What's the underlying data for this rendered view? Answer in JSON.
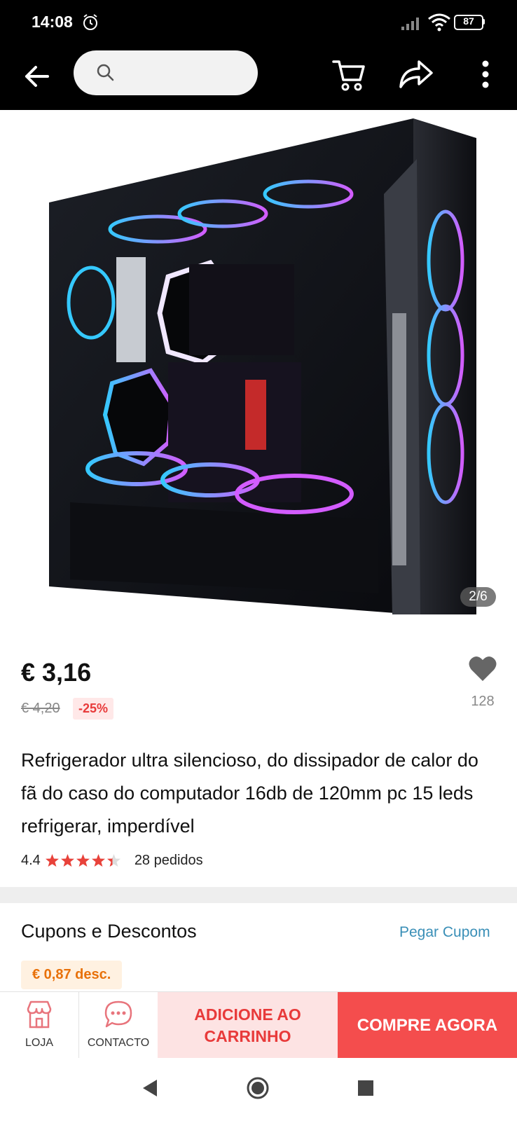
{
  "status_bar": {
    "time": "14:08",
    "battery_level": "87",
    "icons": [
      "alarm-icon",
      "signal-icon",
      "wifi-icon",
      "battery-icon"
    ]
  },
  "top_bar": {
    "search_placeholder": "",
    "icons": [
      "back-arrow-icon",
      "search-icon",
      "cart-icon",
      "share-icon",
      "more-vertical-icon"
    ]
  },
  "product": {
    "image_description_icon": "pc-case-image",
    "image_counter": "2/6",
    "price": "€ 3,16",
    "old_price": "€ 4,20",
    "discount": "-25%",
    "wishlist_count": "128",
    "title": "Refrigerador ultra silencioso, do dissipador de calor do fã do caso do computador 16db de 120mm pc 15 leds refrigerar, imperdível",
    "rating": "4.4",
    "rating_stars": 4.4,
    "orders": "28 pedidos"
  },
  "coupons": {
    "title": "Cupons e Descontos",
    "link": "Pegar Cupom",
    "chip": "€ 0,87 desc."
  },
  "actions": {
    "store_label": "LOJA",
    "contact_label": "CONTACTO",
    "add_to_cart": "ADICIONE AO CARRINHO",
    "buy_now": "COMPRE AGORA"
  },
  "colors": {
    "accent_red": "#f44d4d",
    "add_cart_bg": "#fde3e3",
    "link_blue": "#3a8fb7",
    "coupon_orange": "#e8710a"
  }
}
